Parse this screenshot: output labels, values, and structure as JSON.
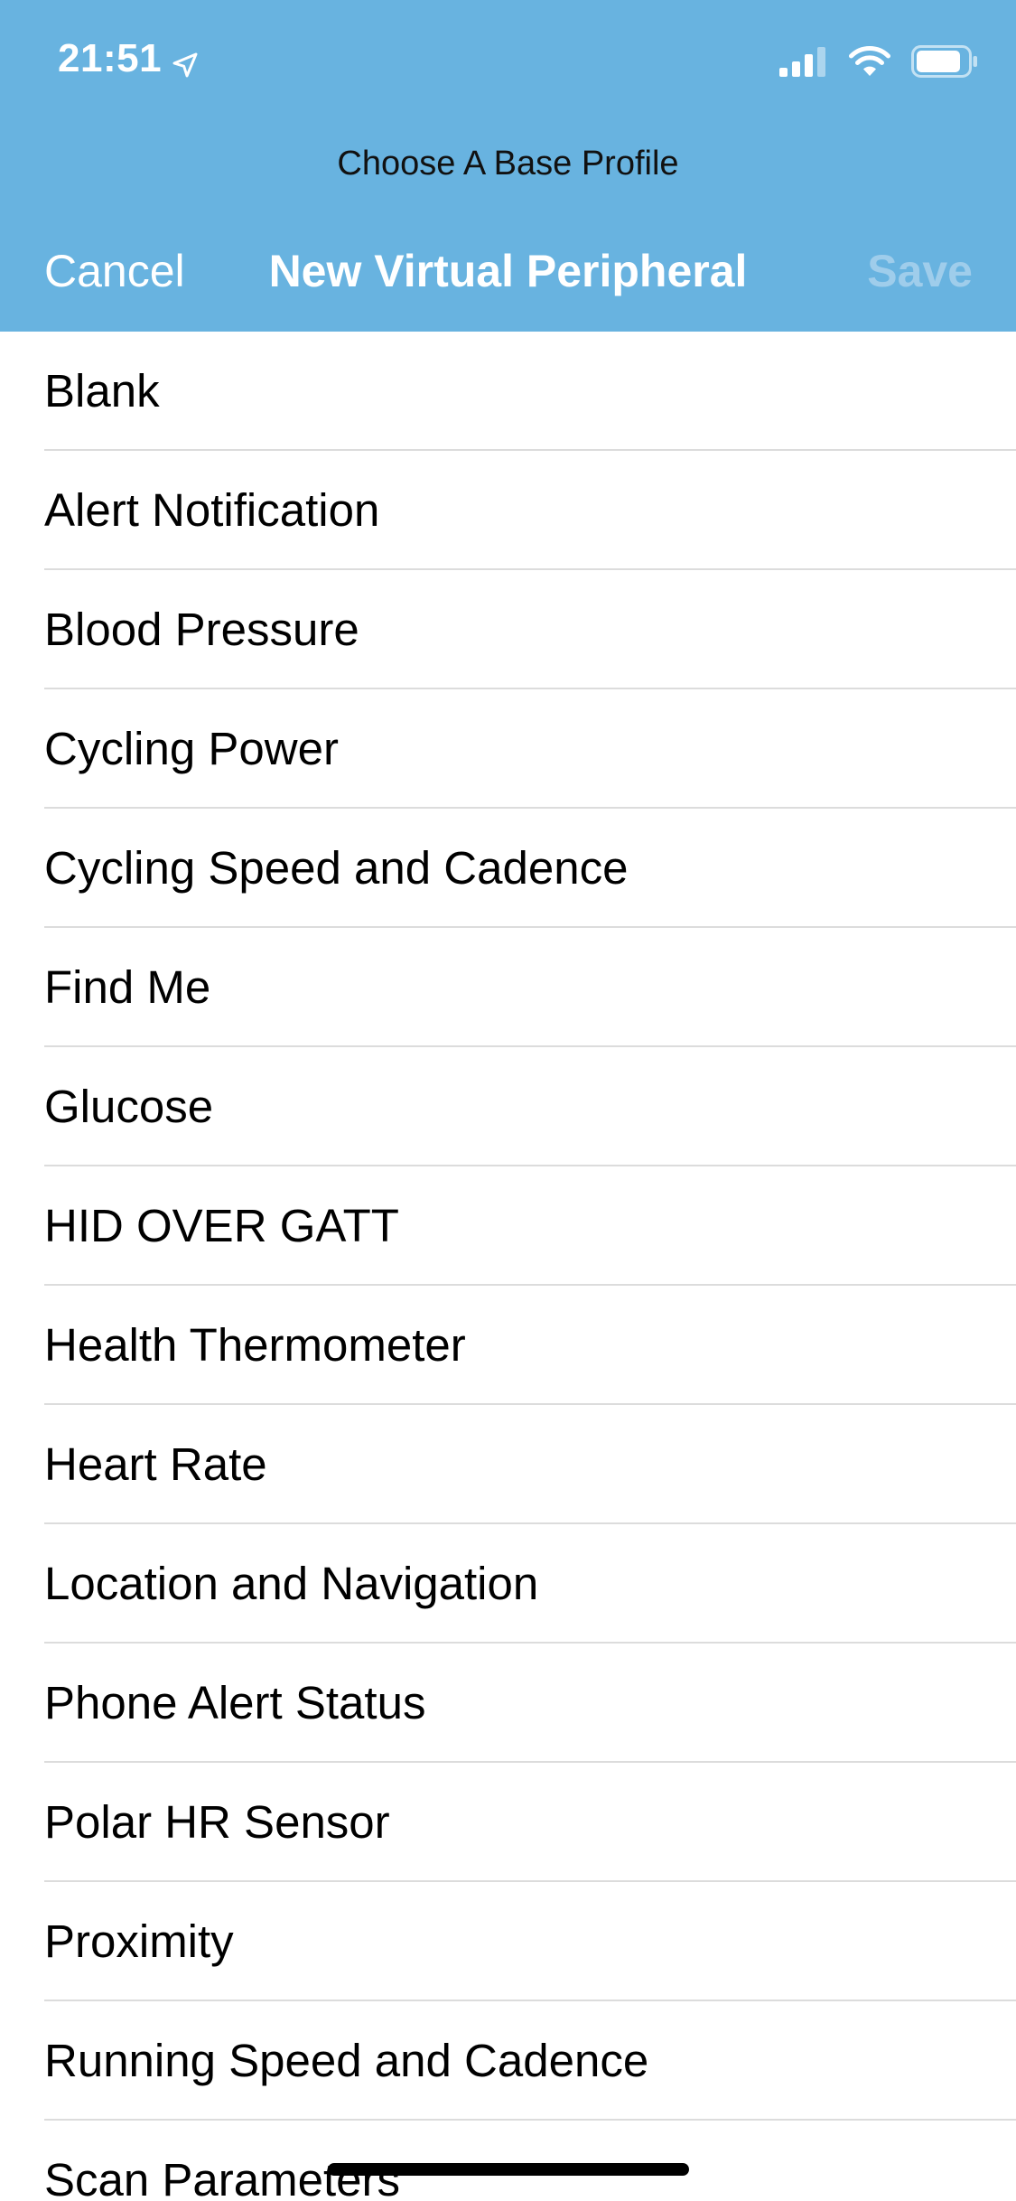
{
  "status_bar": {
    "time": "21:51",
    "icons": [
      "location-arrow-icon",
      "cellular-signal-icon",
      "wifi-icon",
      "battery-icon"
    ]
  },
  "header": {
    "prompt": "Choose A Base Profile",
    "cancel_label": "Cancel",
    "title": "New Virtual Peripheral",
    "save_label": "Save",
    "colors": {
      "background": "#68b3e0",
      "text": "#ffffff",
      "save_disabled": "#9fcdeb"
    }
  },
  "profiles": [
    "Blank",
    "Alert Notification",
    "Blood Pressure",
    "Cycling Power",
    "Cycling Speed and Cadence",
    "Find Me",
    "Glucose",
    "HID OVER GATT",
    "Health Thermometer",
    "Heart Rate",
    "Location and Navigation",
    "Phone Alert Status",
    "Polar HR Sensor",
    "Proximity",
    "Running Speed and Cadence",
    "Scan Parameters"
  ]
}
